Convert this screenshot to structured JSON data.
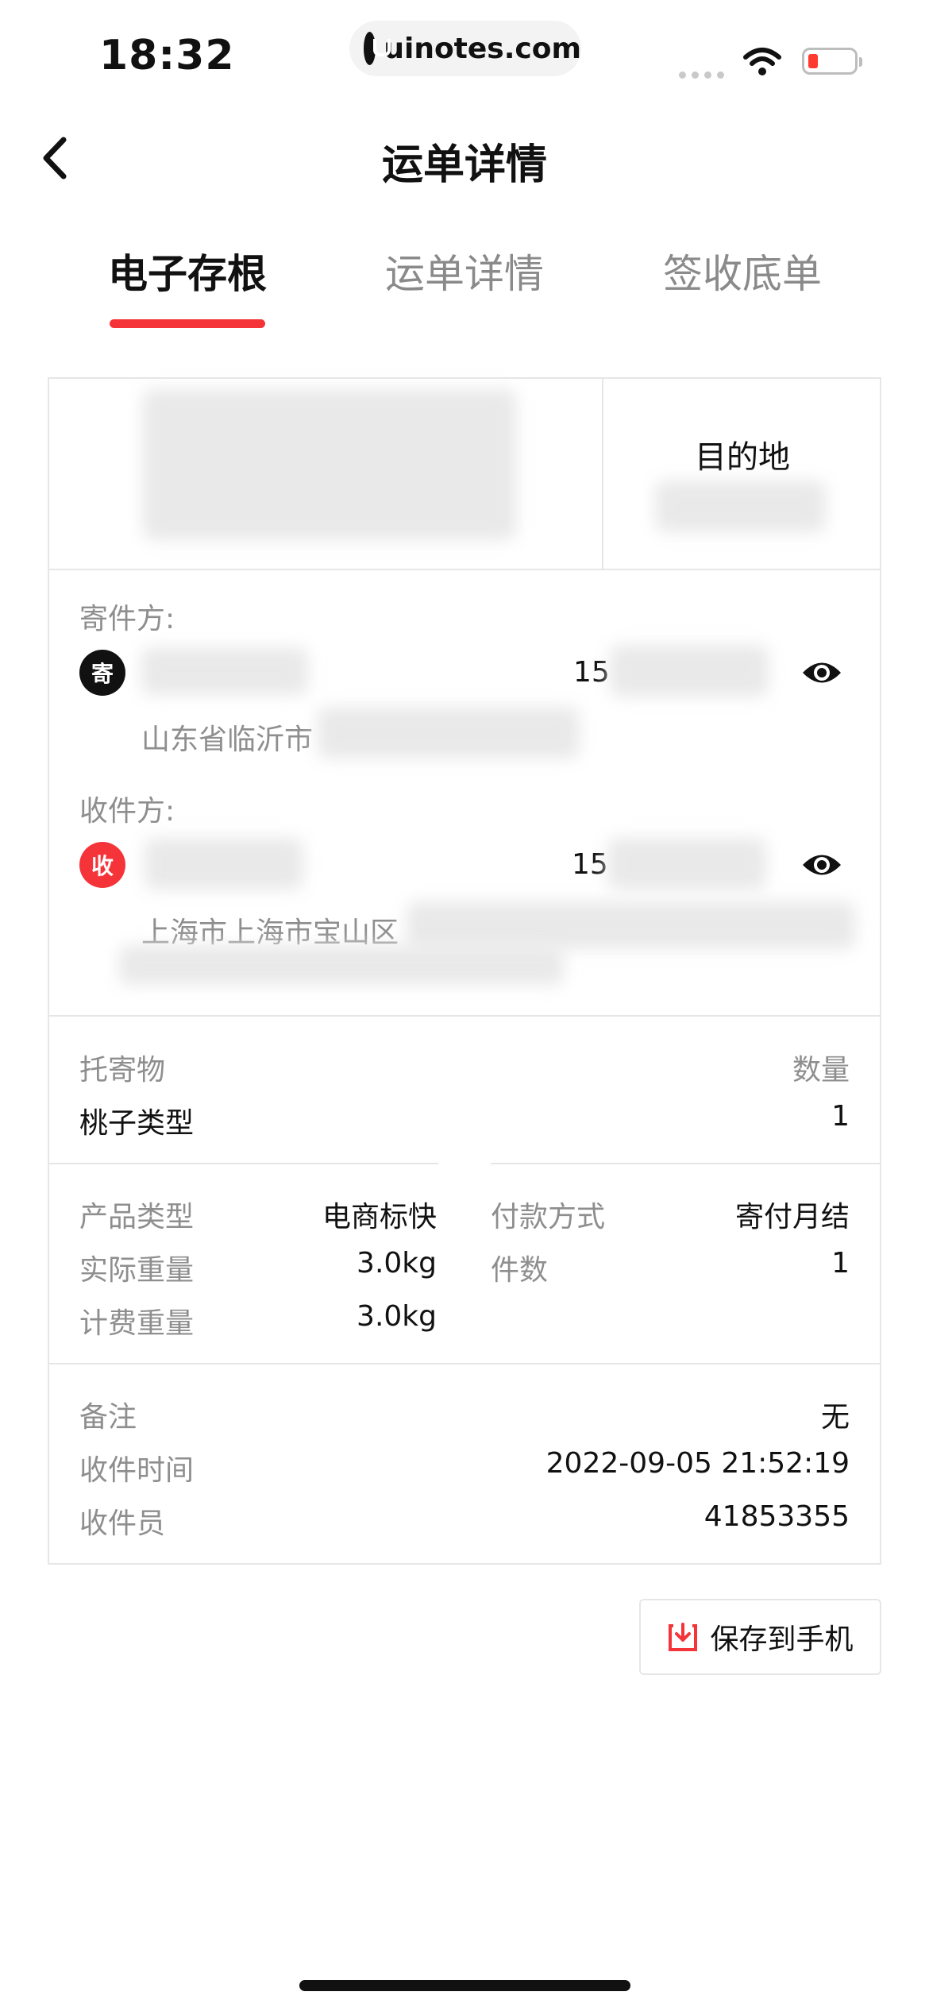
{
  "status_bar": {
    "time": "18:32",
    "url": "uinotes.com"
  },
  "nav": {
    "title": "运单详情"
  },
  "tabs": [
    {
      "label": "电子存根",
      "active": true
    },
    {
      "label": "运单详情",
      "active": false
    },
    {
      "label": "签收底单",
      "active": false
    }
  ],
  "stub": {
    "destination_label": "目的地",
    "sender": {
      "section_label": "寄件方:",
      "badge": "寄",
      "phone_prefix": "15",
      "address": "山东省临沂市"
    },
    "receiver": {
      "section_label": "收件方:",
      "badge": "收",
      "phone_prefix": "15",
      "address": "上海市上海市宝山区"
    },
    "goods": {
      "label": "托寄物",
      "value": "桃子类型",
      "qty_label": "数量",
      "qty_value": "1"
    },
    "details_left": [
      {
        "label": "产品类型",
        "value": "电商标快"
      },
      {
        "label": "实际重量",
        "value": "3.0kg"
      },
      {
        "label": "计费重量",
        "value": "3.0kg"
      }
    ],
    "details_right": [
      {
        "label": "付款方式",
        "value": "寄付月结"
      },
      {
        "label": "件数",
        "value": "1"
      }
    ],
    "footer_rows": [
      {
        "label": "备注",
        "value": "无"
      },
      {
        "label": "收件时间",
        "value": "2022-09-05 21:52:19"
      },
      {
        "label": "收件员",
        "value": "41853355"
      }
    ]
  },
  "save_button": {
    "label": "保存到手机"
  },
  "colors": {
    "accent": "#f5343a",
    "receiver_badge": "#f5343a",
    "sender_badge": "#111111"
  }
}
